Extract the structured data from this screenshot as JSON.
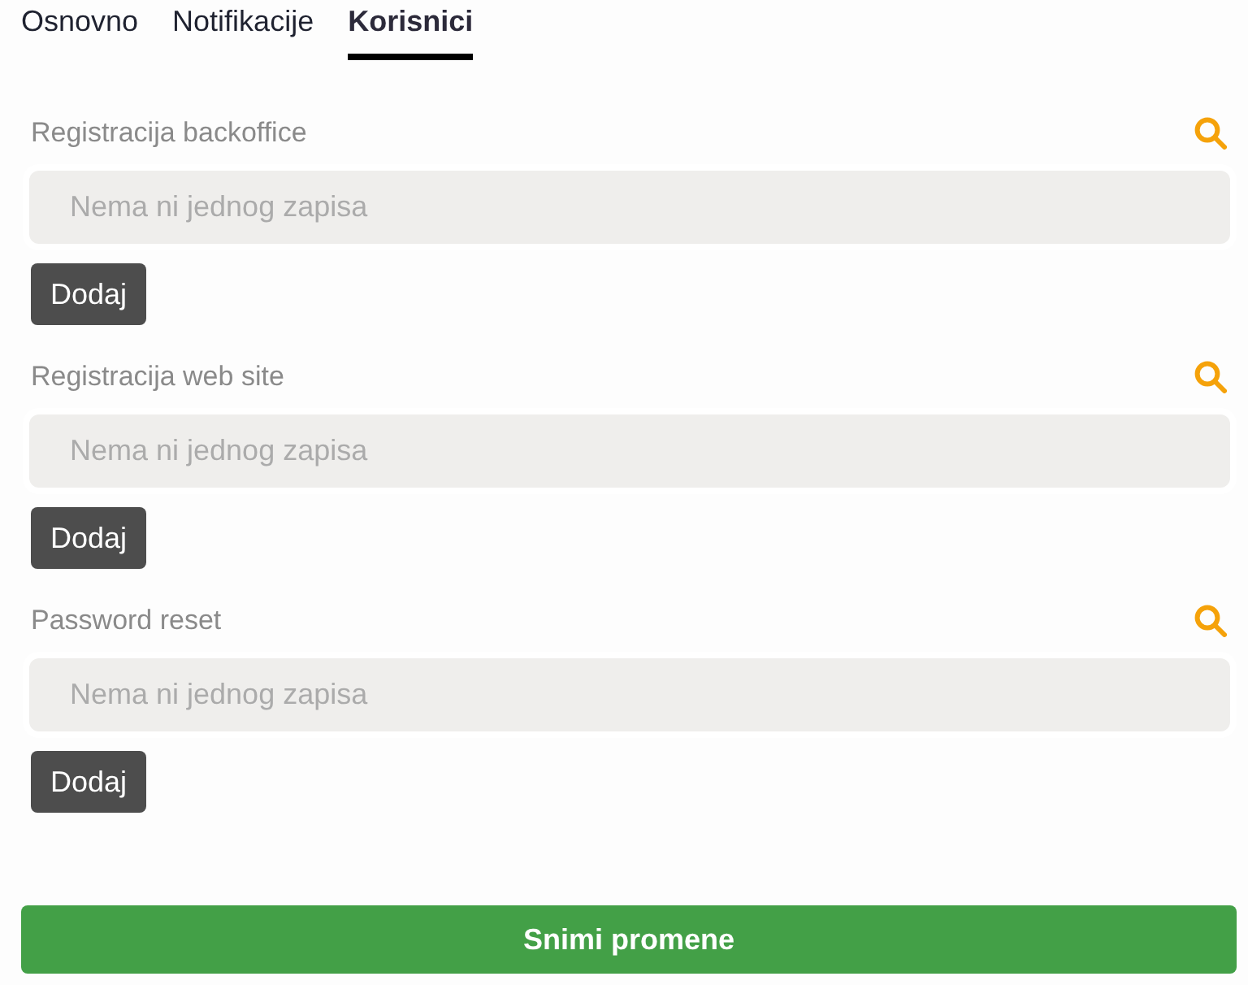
{
  "tabs": [
    {
      "label": "Osnovno",
      "selected": false
    },
    {
      "label": "Notifikacije",
      "selected": false
    },
    {
      "label": "Korisnici",
      "selected": true
    }
  ],
  "sections": [
    {
      "title": "Registracija backoffice",
      "empty_text": "Nema ni jednog zapisa",
      "add_button": "Dodaj"
    },
    {
      "title": "Registracija web site",
      "empty_text": "Nema ni jednog zapisa",
      "add_button": "Dodaj"
    },
    {
      "title": "Password reset",
      "empty_text": "Nema ni jednog zapisa",
      "add_button": "Dodaj"
    }
  ],
  "save_button": "Snimi promene"
}
